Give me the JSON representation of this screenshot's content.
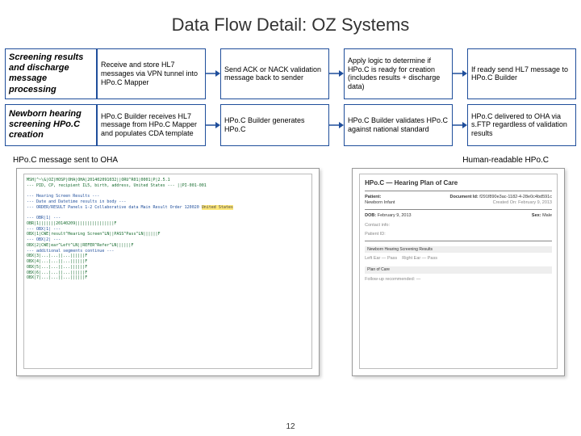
{
  "title": "Data Flow Detail: OZ Systems",
  "rows": [
    {
      "label": "Screening results and discharge message processing",
      "steps": [
        "Receive and store HL7 messages via VPN tunnel into HPo.C Mapper",
        "Send ACK or NACK validation message back to sender",
        "Apply logic to determine if HPo.C is ready for creation (includes results + discharge data)",
        "If ready send HL7 message to HPo.C Builder"
      ]
    },
    {
      "label": "Newborn hearing screening HPo.C creation",
      "steps": [
        "HPo.C Builder receives HL7 message from HPo.C Mapper and populates CDA template",
        "HPo.C Builder generates HPo.C",
        "HPo.C Builder validates HPo.C against national standard",
        "HPo.C delivered to OHA via s.FTP regardless of validation results"
      ]
    }
  ],
  "previews": {
    "left_label": "HPo.C message sent to OHA",
    "right_label": "Human-readable HPo.C"
  },
  "hl7_sample": {
    "l1": "MSH|^~\\&|OZ|HOSP|OHA|OHA|201402091032||ORU^R01|0001|P|2.5.1",
    "l2": "--- PID, CP, recipient IL5, birth, address, United States --- ||PI-001-001",
    "l3": "--- Hearing Screen Results ---",
    "l4": "--- Date and Datetime results in body ---",
    "l5": "--- ORDER/RESULT Panels 1-2 Collaborative data Main Result Order 120020",
    "l6": "--- OBR|1| ---",
    "l7": "OBR|1|||||||20140209||||||||||||||||F",
    "l8": "--- OBX|1| ---",
    "l9": "OBX|1|CWE|result^Hearing Screen^LN||PASS^Pass^LN||||||F",
    "l10": "--- OBX|2| ---",
    "l11": "OBX|2|CWE|ear^Left^LN||REFER^Refer^LN||||||F",
    "l12": "--- additional segments continue ---"
  },
  "doc_sample": {
    "heading": "HPo.C — Hearing Plan of Care",
    "patient_lbl": "Patient:",
    "patient_val": "Newborn Infant",
    "id_lbl": "Document Id:",
    "id_val": "f291f890e3ac-1182-4-28e0c4bd591c",
    "dob_lbl": "DOB:",
    "dob_val": "February 9, 2013",
    "sex_lbl": "Sex:",
    "sex_val": "Male",
    "created_lbl": "Created On:",
    "created_val": "February 9, 2013",
    "band1": "Newborn Hearing Screening Results",
    "band2": "Plan of Care"
  },
  "page_number": "12"
}
